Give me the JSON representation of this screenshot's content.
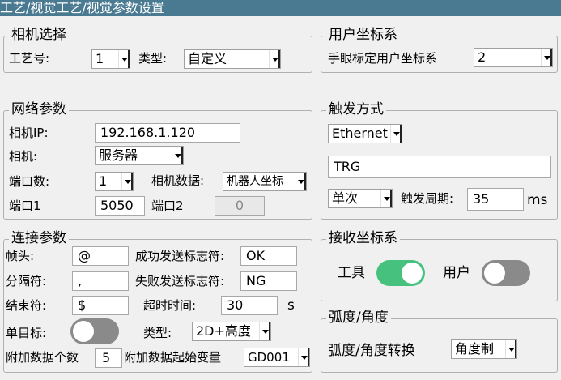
{
  "title": "工艺/视觉工艺/视觉参数设置",
  "camera_select": {
    "legend": "相机选择",
    "process_label": "工艺号:",
    "process_value": "1",
    "type_label": "类型:",
    "type_value": "自定义"
  },
  "user_coord": {
    "legend": "用户坐标系",
    "label": "手眼标定用户坐标系",
    "value": "2"
  },
  "network": {
    "legend": "网络参数",
    "ip_label": "相机IP:",
    "ip_value": "192.168.1.120",
    "camera_label": "相机:",
    "camera_value": "服务器",
    "port_count_label": "端口数:",
    "port_count_value": "1",
    "camera_data_label": "相机数据:",
    "camera_data_value": "机器人坐标",
    "port1_label": "端口1",
    "port1_value": "5050",
    "port2_label": "端口2",
    "port2_value": "0"
  },
  "trigger": {
    "legend": "触发方式",
    "mode_value": "Ethernet",
    "command_value": "TRG",
    "count_value": "单次",
    "period_label": "触发周期:",
    "period_value": "35",
    "period_unit": "ms"
  },
  "connection": {
    "legend": "连接参数",
    "header_label": "帧头:",
    "header_value": "@",
    "success_label": "成功发送标志符:",
    "success_value": "OK",
    "separator_label": "分隔符:",
    "separator_value": ",",
    "fail_label": "失败发送标志符:",
    "fail_value": "NG",
    "end_label": "结束符:",
    "end_value": "$",
    "timeout_label": "超时时间:",
    "timeout_value": "30",
    "timeout_unit": "s",
    "single_target_label": "单目标:",
    "single_target_on": false,
    "type_label": "类型:",
    "type_value": "2D+高度",
    "extra_count_label": "附加数据个数",
    "extra_count_value": "5",
    "extra_start_label": "附加数据起始变量",
    "extra_start_value": "GD001"
  },
  "receive_coord": {
    "legend": "接收坐标系",
    "tool_label": "工具",
    "tool_on": true,
    "user_label": "用户",
    "user_on": false
  },
  "arc_angle": {
    "legend": "弧度/角度",
    "convert_label": "弧度/角度转换",
    "convert_value": "角度制"
  },
  "colors": {
    "titlebar": "#4a7a92",
    "toggle_on": "#46c27e",
    "toggle_off": "#8a8a8a"
  }
}
